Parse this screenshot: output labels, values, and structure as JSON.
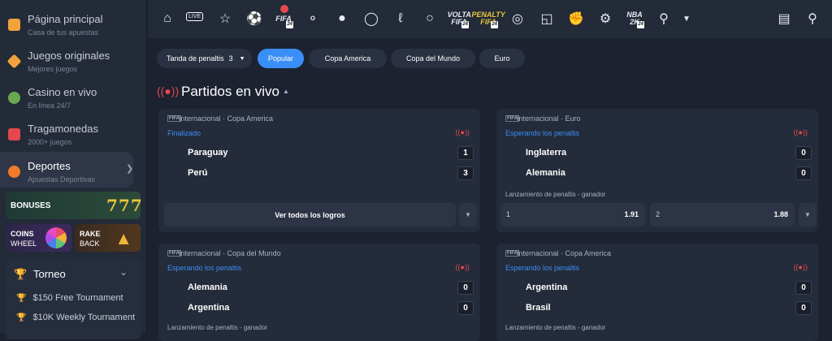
{
  "sidebar": {
    "items": [
      {
        "title": "Página principal",
        "subtitle": "Casa de tus apuestas"
      },
      {
        "title": "Juegos originales",
        "subtitle": "Mejores juegos"
      },
      {
        "title": "Casino en vivo",
        "subtitle": "En línea 24/7"
      },
      {
        "title": "Tragamonedas",
        "subtitle": "2000+ juegos"
      },
      {
        "title": "Deportes",
        "subtitle": "Apuestas Deportivas"
      }
    ],
    "bonuses": {
      "label": "BONUSES",
      "number": "777"
    },
    "coins": {
      "line1": "COINS",
      "line2": "WHEEL"
    },
    "rake": {
      "line1": "RAKE",
      "line2": "BACK"
    },
    "torneo": {
      "title": "Torneo",
      "items": [
        "$150 Free Tournament",
        "$10K Weekly Tournament"
      ]
    }
  },
  "topbar": {
    "icons": [
      "home-icon",
      "live-icon",
      "star-icon",
      "soccer-icon",
      "fifa-icon",
      "headset-icon",
      "basketball-icon",
      "tennis-icon",
      "hockey-icon",
      "volleyball-icon",
      "volta-fifa-icon",
      "penalty-fifa-icon",
      "ping-pong-icon",
      "chat-ball-icon",
      "fist-icon",
      "esports-icon",
      "nba2k-icon",
      "cricket-icon",
      "more-chevron-icon"
    ],
    "live_label": "LIVE",
    "fifa_label": "FIFA",
    "volta_label": "VOLTA FIFA",
    "penalty_label": "PENALTY FIFA",
    "nba_label": "NBA 2K",
    "badge_24": "24"
  },
  "filters": {
    "tanda": {
      "label": "Tanda de penaltis",
      "count": "3"
    },
    "chips": [
      "Popular",
      "Copa America",
      "Copa del Mundo",
      "Euro"
    ]
  },
  "section": {
    "title": "Partidos en vivo"
  },
  "matches": [
    {
      "league_badge": "FIFA",
      "competition": "Internacional · Copa America",
      "status": "Finalizado",
      "teams": [
        {
          "name": "Paraguay",
          "score": "1"
        },
        {
          "name": "Perú",
          "score": "3"
        }
      ],
      "all_odds_label": "Ver todos los logros"
    },
    {
      "league_badge": "FIFA",
      "competition": "Internacional · Euro",
      "status": "Esperando los penaltis",
      "teams": [
        {
          "name": "Inglaterra",
          "score": "0"
        },
        {
          "name": "Alemania",
          "score": "0"
        }
      ],
      "market": "Lanzamiento de penaltis - ganador",
      "odds": [
        {
          "key": "1",
          "value": "1.91"
        },
        {
          "key": "2",
          "value": "1.88"
        }
      ]
    },
    {
      "league_badge": "FIFA",
      "competition": "Internacional · Copa del Mundo",
      "status": "Esperando los penaltis",
      "teams": [
        {
          "name": "Alemania",
          "score": "0"
        },
        {
          "name": "Argentina",
          "score": "0"
        }
      ],
      "market": "Lanzamiento de penaltis - ganador"
    },
    {
      "league_badge": "FIFA",
      "competition": "Internacional · Copa America",
      "status": "Esperando los penaltis",
      "teams": [
        {
          "name": "Argentina",
          "score": "0"
        },
        {
          "name": "Brasil",
          "score": "0"
        }
      ],
      "market": "Lanzamiento de penaltis - ganador"
    }
  ],
  "colors": {
    "accent": "#3a8ef7",
    "live": "#e5484d",
    "gold": "#e8c63c"
  }
}
